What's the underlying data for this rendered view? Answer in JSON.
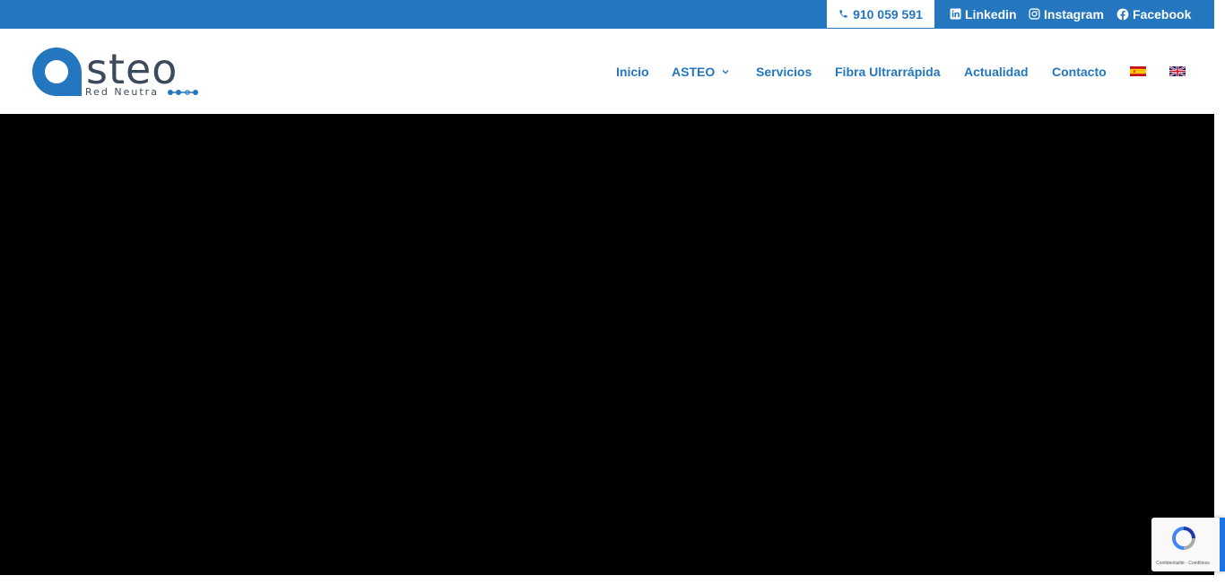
{
  "topbar": {
    "phone": "910 059 591",
    "linkedin": "Linkedin",
    "instagram": "Instagram",
    "facebook": "Facebook"
  },
  "brand": {
    "name": "asteo",
    "tagline": "Red Neutra"
  },
  "nav": {
    "items": [
      "Inicio",
      "ASTEO",
      "Servicios",
      "Fibra Ultrarrápida",
      "Actualidad",
      "Contacto"
    ]
  },
  "recaptcha": {
    "terms": "Confidentialité - Conditions"
  },
  "colors": {
    "primary": "#2477be",
    "logo_dark": "#3c4a5c",
    "video_bg": "#000000"
  }
}
